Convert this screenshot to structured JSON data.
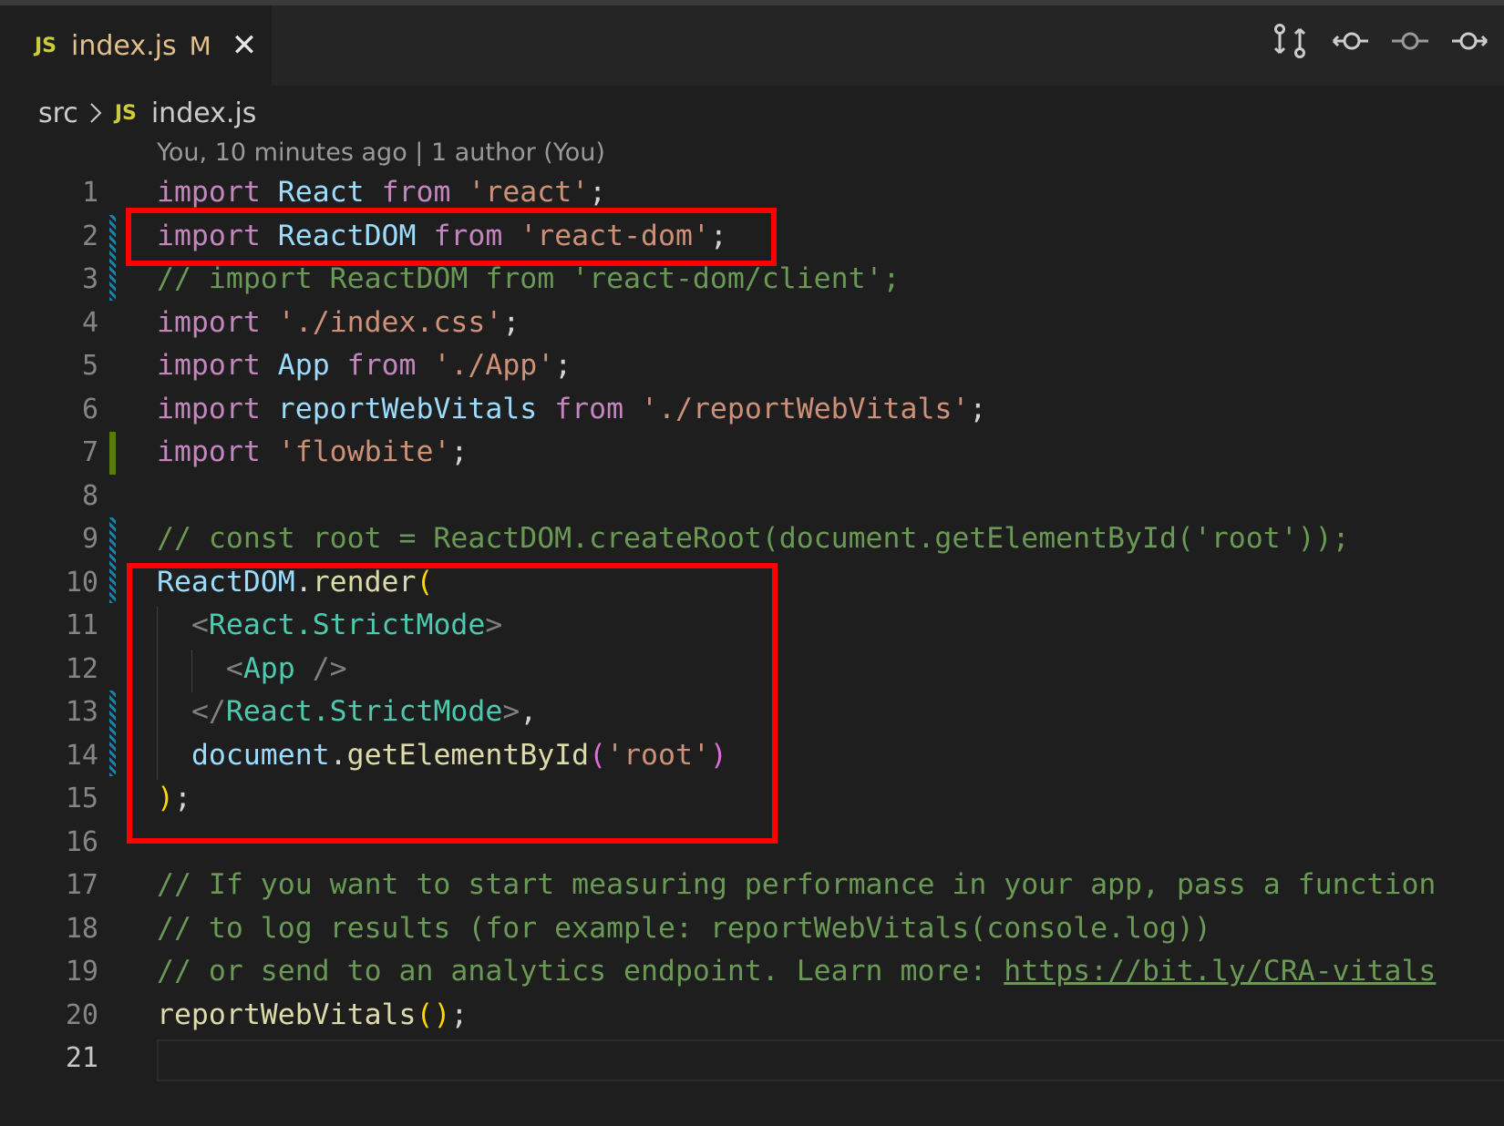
{
  "tab": {
    "lang_badge": "JS",
    "filename": "index.js",
    "status": "M",
    "close_glyph": "✕"
  },
  "toolbar_icons": [
    "open-changes-icon",
    "go-to-previous-change-icon",
    "current-change-icon",
    "go-to-next-change-icon"
  ],
  "breadcrumb": {
    "folder": "src",
    "lang_badge": "JS",
    "file": "index.js"
  },
  "codelens": "You, 10 minutes ago | 1 author (You)",
  "lines": [
    {
      "n": "1"
    },
    {
      "n": "2"
    },
    {
      "n": "3"
    },
    {
      "n": "4"
    },
    {
      "n": "5"
    },
    {
      "n": "6"
    },
    {
      "n": "7"
    },
    {
      "n": "8"
    },
    {
      "n": "9"
    },
    {
      "n": "10"
    },
    {
      "n": "11"
    },
    {
      "n": "12"
    },
    {
      "n": "13"
    },
    {
      "n": "14"
    },
    {
      "n": "15"
    },
    {
      "n": "16"
    },
    {
      "n": "17"
    },
    {
      "n": "18"
    },
    {
      "n": "19"
    },
    {
      "n": "20"
    },
    {
      "n": "21"
    }
  ],
  "code": {
    "l1": {
      "a": "import",
      "b": "React",
      "c": "from",
      "d": "'react'",
      "e": ";"
    },
    "l2": {
      "a": "import",
      "b": "ReactDOM",
      "c": "from",
      "d": "'react-dom'",
      "e": ";"
    },
    "l3": "// import ReactDOM from 'react-dom/client';",
    "l4": {
      "a": "import",
      "d": "'./index.css'",
      "e": ";"
    },
    "l5": {
      "a": "import",
      "b": "App",
      "c": "from",
      "d": "'./App'",
      "e": ";"
    },
    "l6": {
      "a": "import",
      "b": "reportWebVitals",
      "c": "from",
      "d": "'./reportWebVitals'",
      "e": ";"
    },
    "l7": {
      "a": "import",
      "d": "'flowbite'",
      "e": ";"
    },
    "l9": "// const root = ReactDOM.createRoot(document.getElementById('root'));",
    "l10": {
      "obj": "ReactDOM",
      "dot": ".",
      "fn": "render",
      "br": "("
    },
    "l11": {
      "lt": "<",
      "tag": "React.StrictMode",
      "gt": ">"
    },
    "l12": {
      "lt": "<",
      "tag": "App",
      "end": " />"
    },
    "l13": {
      "lt": "</",
      "tag": "React.StrictMode",
      "gt": ">",
      "comma": ","
    },
    "l14": {
      "obj": "document",
      "dot": ".",
      "fn": "getElementById",
      "br1": "(",
      "str": "'root'",
      "br2": ")"
    },
    "l15": {
      "br": ")",
      "semi": ";"
    },
    "l17": "// If you want to start measuring performance in your app, pass a function",
    "l18": "// to log results (for example: reportWebVitals(console.log))",
    "l19": {
      "text": "// or send to an analytics endpoint. Learn more: ",
      "link": "https://bit.ly/CRA-vitals"
    },
    "l20": {
      "fn": "reportWebVitals",
      "br": "()",
      "semi": ";"
    }
  },
  "colors": {
    "highlight_box": "#ff0000",
    "diff_modified": "#1b81a8",
    "diff_added": "#587c0c"
  }
}
